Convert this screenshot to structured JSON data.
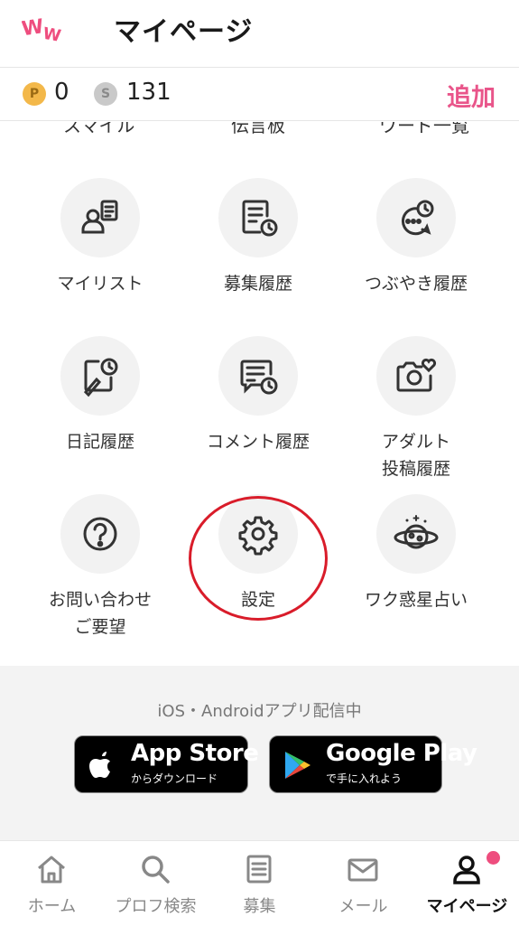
{
  "header": {
    "title": "マイページ",
    "logo": "WW"
  },
  "points": {
    "p_icon": "P",
    "p_value": "0",
    "s_icon": "S",
    "s_value": "131",
    "add_label": "追加"
  },
  "grid": {
    "cut_labels": [
      "スマイル",
      "伝言板",
      "ワード一覧"
    ],
    "tiles": [
      {
        "label": "マイリスト",
        "icon": "person-list-icon"
      },
      {
        "label": "募集履歴",
        "icon": "document-clock-icon"
      },
      {
        "label": "つぶやき履歴",
        "icon": "chat-clock-icon"
      },
      {
        "label": "日記履歴",
        "icon": "diary-clock-icon"
      },
      {
        "label": "コメント履歴",
        "icon": "comment-clock-icon"
      },
      {
        "label": "アダルト\n投稿履歴",
        "icon": "camera-heart-icon"
      },
      {
        "label": "お問い合わせ\nご要望",
        "icon": "question-icon"
      },
      {
        "label": "設定",
        "icon": "gear-icon"
      },
      {
        "label": "ワク惑星占い",
        "icon": "planet-icon"
      }
    ]
  },
  "apps": {
    "caption": "iOS・Androidアプリ配信中",
    "app_store": {
      "main": "App Store",
      "sub": "からダウンロード"
    },
    "google_play": {
      "main": "Google Play",
      "sub": "で手に入れよう"
    }
  },
  "tabbar": {
    "tabs": [
      {
        "label": "ホーム",
        "icon": "home-icon"
      },
      {
        "label": "プロフ検索",
        "icon": "search-icon"
      },
      {
        "label": "募集",
        "icon": "list-icon"
      },
      {
        "label": "メール",
        "icon": "mail-icon"
      },
      {
        "label": "マイページ",
        "icon": "person-icon"
      }
    ],
    "active": "マイページ"
  },
  "colors": {
    "accent": "#e9558a",
    "highlight": "#d91c2a",
    "badge": "#ee4d7e"
  }
}
